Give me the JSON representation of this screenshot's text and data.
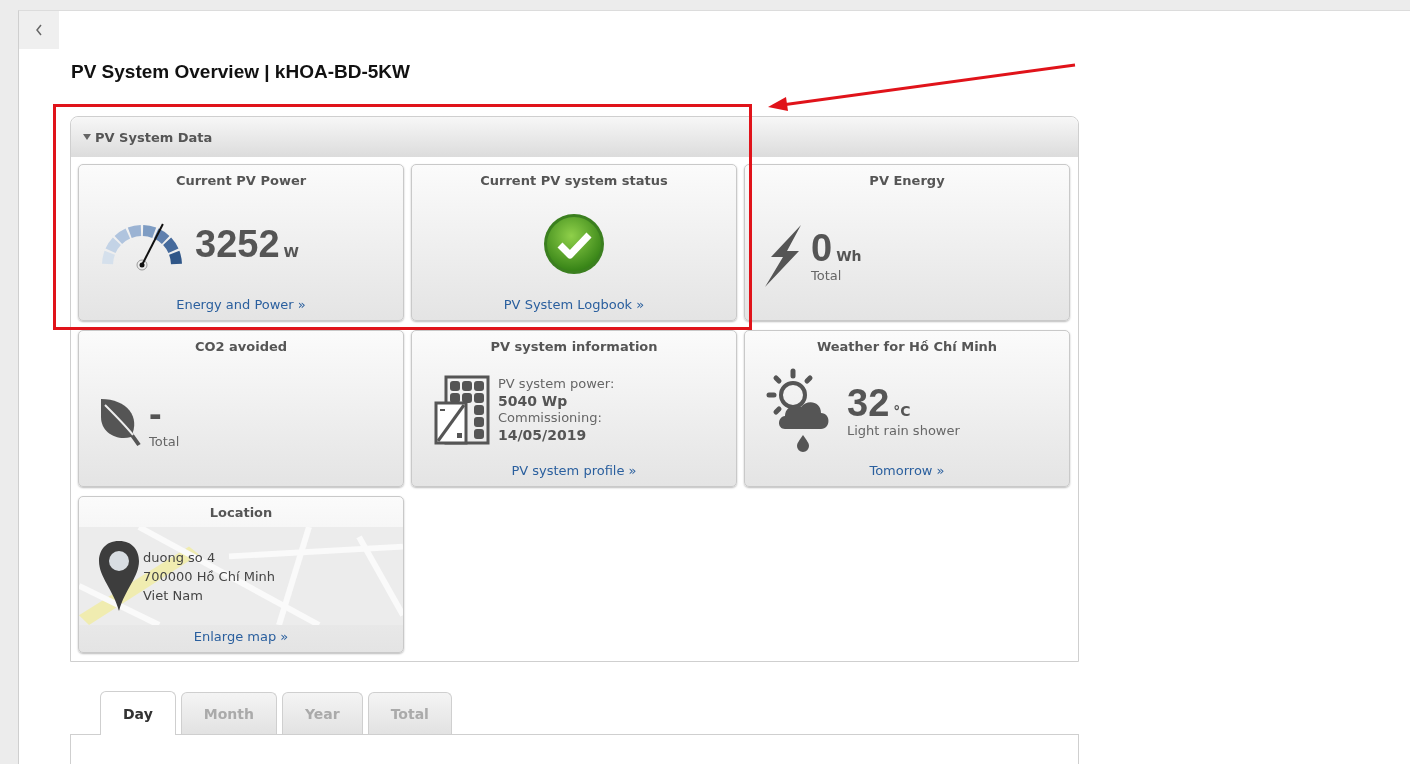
{
  "page": {
    "title": "PV System Overview | kHOA-BD-5KW"
  },
  "panel": {
    "title": "PV System Data",
    "expanded": true,
    "cards": [
      {
        "kind": "power",
        "title": "Current PV Power",
        "value": "3252",
        "unit": "W",
        "level": 0.65,
        "link": "Energy and Power »"
      },
      {
        "kind": "status",
        "title": "Current PV system status",
        "ok": true,
        "link": "PV System Logbook »"
      },
      {
        "kind": "energy",
        "title": "PV Energy",
        "value": "0",
        "unit": "Wh",
        "caption": "Total"
      },
      {
        "kind": "co2",
        "title": "CO2 avoided",
        "value": "-",
        "caption": "Total"
      },
      {
        "kind": "info",
        "title": "PV system information",
        "lines": [
          {
            "label": "PV system power:",
            "value": "5040 Wp"
          },
          {
            "label": "Commissioning:",
            "value": "14/05/2019"
          }
        ],
        "link": "PV system profile »"
      },
      {
        "kind": "weather",
        "title": "Weather for Hồ Chí Minh",
        "value": "32",
        "unit": "°C",
        "caption": "Light rain shower",
        "link": "Tomorrow »"
      },
      {
        "kind": "location",
        "title": "Location",
        "address": [
          "duong so 4",
          "700000 Hồ Chí Minh",
          "Viet Nam"
        ],
        "link": "Enlarge map »"
      }
    ]
  },
  "tabs": [
    {
      "label": "Day",
      "selected": true
    },
    {
      "label": "Month",
      "selected": false
    },
    {
      "label": "Year",
      "selected": false
    },
    {
      "label": "Total",
      "selected": false
    }
  ]
}
